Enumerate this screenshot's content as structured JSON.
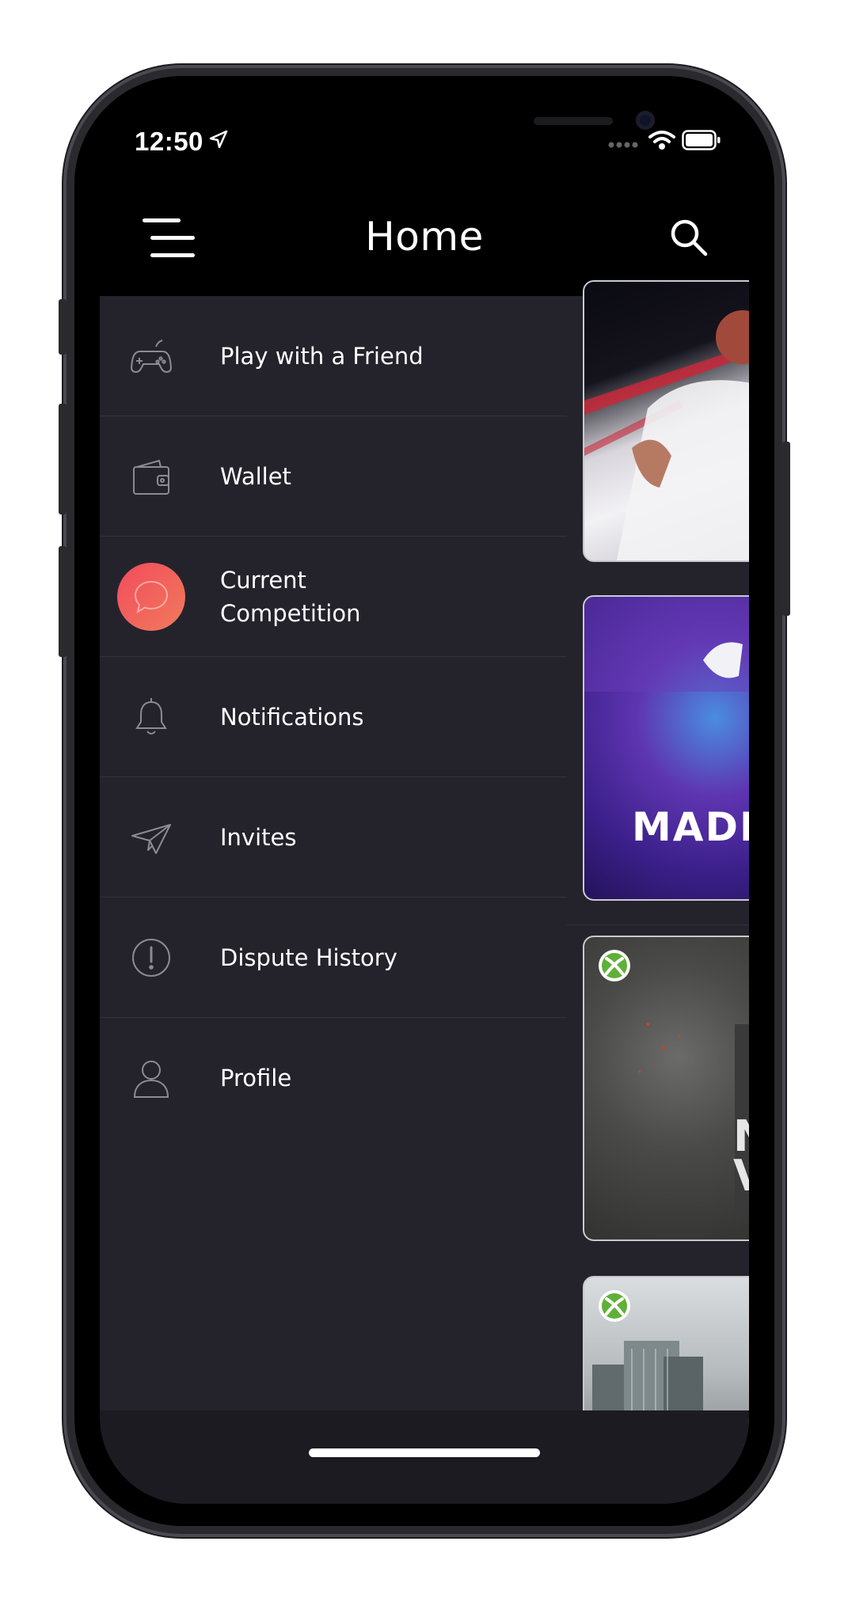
{
  "status_bar": {
    "time": "12:50"
  },
  "header": {
    "title": "Home",
    "menu_icon": "hamburger-menu-icon",
    "search_icon": "search-icon"
  },
  "drawer": {
    "active_color": "#f24b5c",
    "items": [
      {
        "label": "Play with a Friend",
        "icon": "gamepad-icon"
      },
      {
        "label": "Wallet",
        "icon": "wallet-icon"
      },
      {
        "label": "Current\nCompetition",
        "icon": "chat-bubble-icon",
        "active": true
      },
      {
        "label": "Notifications",
        "icon": "bell-icon"
      },
      {
        "label": "Invites",
        "icon": "paper-plane-icon"
      },
      {
        "label": "Dispute History",
        "icon": "alert-circle-icon"
      },
      {
        "label": "Profile",
        "icon": "user-icon"
      }
    ]
  },
  "content": {
    "cards": [
      {
        "platform": null
      },
      {
        "partial_text": "MADD",
        "platform": null
      },
      {
        "platform": "xbox"
      },
      {
        "platform": "xbox"
      }
    ]
  }
}
